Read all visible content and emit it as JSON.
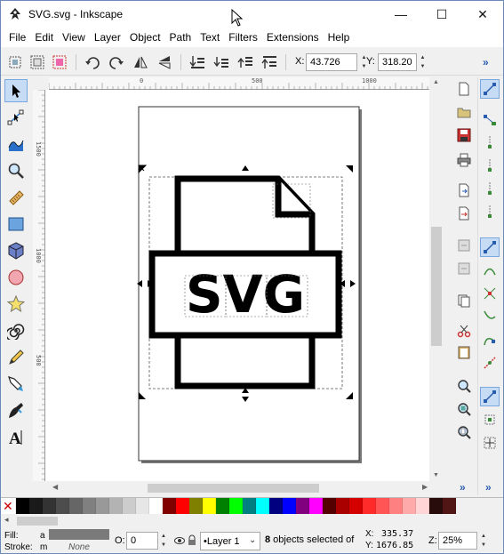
{
  "window": {
    "title": "SVG.svg - Inkscape",
    "minimize": "—",
    "maximize": "☐",
    "close": "✕"
  },
  "menu": [
    "File",
    "Edit",
    "View",
    "Layer",
    "Object",
    "Path",
    "Text",
    "Filters",
    "Extensions",
    "Help"
  ],
  "controls": {
    "x_label": "X:",
    "x_value": "43.726",
    "y_label": "Y:",
    "y_value": "318.208",
    "more": "»"
  },
  "ruler": {
    "top_labels": [
      "0",
      "500",
      "1000"
    ],
    "left_labels": [
      "1500",
      "1000",
      "500"
    ]
  },
  "drawing": {
    "text": "SVG"
  },
  "palette": {
    "none_label": "✕",
    "colors": [
      "#000000",
      "#1a1a1a",
      "#333333",
      "#4d4d4d",
      "#666666",
      "#808080",
      "#999999",
      "#b3b3b3",
      "#cccccc",
      "#e6e6e6",
      "#ffffff",
      "#800000",
      "#ff0000",
      "#808000",
      "#ffff00",
      "#008000",
      "#00ff00",
      "#008080",
      "#00ffff",
      "#000080",
      "#0000ff",
      "#800080",
      "#ff00ff",
      "#550000",
      "#aa0000",
      "#d40000",
      "#ff2a2a",
      "#ff5555",
      "#ff8080",
      "#ffaaaa",
      "#ffd5d5",
      "#280b0b",
      "#501616"
    ],
    "more": "◂"
  },
  "status": {
    "fill_label": "Fill:",
    "fill_value": "a",
    "stroke_label": "Stroke:",
    "stroke_value": "m",
    "stroke_none": "None",
    "opacity_label": "O:",
    "opacity_value": "0",
    "layer": "•Layer 1",
    "message_bold": "8",
    "message": " objects selected of",
    "x_label": "X:",
    "x_value": "335.37",
    "y_label": "Y:",
    "y_value": "1676.85",
    "zoom_label": "Z:",
    "zoom_value": "25%"
  }
}
